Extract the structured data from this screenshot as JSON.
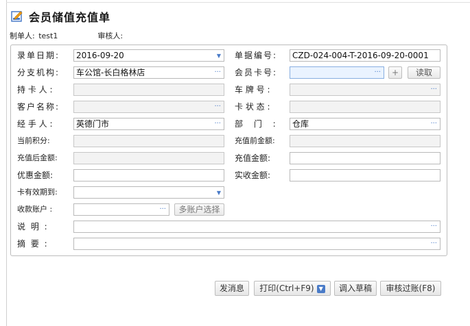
{
  "title": "会员储值充值单",
  "meta": {
    "creator_label": "制单人:",
    "creator_value": "test1",
    "reviewer_label": "审核人:"
  },
  "form": {
    "entry_date": {
      "label": "录单日期:",
      "value": "2016-09-20"
    },
    "doc_no": {
      "label": "单据编号:",
      "value": "CZD-024-004-T-2016-09-20-0001"
    },
    "branch": {
      "label": "分支机构:",
      "value": "车公馆-长白格林店"
    },
    "member_card": {
      "label": "会员卡号:",
      "value": ""
    },
    "cardholder": {
      "label": "持 卡 人 :",
      "value": ""
    },
    "plate_no": {
      "label": "车 牌 号 :",
      "value": ""
    },
    "customer_name": {
      "label": "客户名称:",
      "value": ""
    },
    "card_status": {
      "label": "卡 状 态 :",
      "value": ""
    },
    "handler": {
      "label": "经 手 人 :",
      "value": "英德门市"
    },
    "department": {
      "label": "部  门  :",
      "value": "仓库"
    },
    "current_points": {
      "label": "当前积分:",
      "value": ""
    },
    "pre_recharge": {
      "label": "充值前金额:",
      "value": ""
    },
    "post_recharge": {
      "label": "充值后金额:",
      "value": ""
    },
    "recharge_amount": {
      "label": "充值金额:",
      "value": ""
    },
    "discount_amount": {
      "label": "优惠金额:",
      "value": ""
    },
    "actual_received": {
      "label": "实收金额:",
      "value": ""
    },
    "card_expiry": {
      "label": "卡有效期到:",
      "value": ""
    },
    "receipt_account": {
      "label": "收款账户 :",
      "value": ""
    },
    "multi_account_btn": "多账户选择",
    "remark": {
      "label": "说  明  :",
      "value": ""
    },
    "summary": {
      "label": "摘  要  :",
      "value": ""
    },
    "add_btn": "+",
    "read_btn": "读取"
  },
  "icons": {
    "ellipsis": "···",
    "dropdown": "▼",
    "title_icon": "edit-icon"
  },
  "actions": {
    "send_message": "发消息",
    "print": "打印(Ctrl+F9)",
    "load_draft": "调入草稿",
    "review_post": "审核过账(F8)"
  },
  "colors": {
    "accent": "#4a7bc8",
    "focus_bg": "#eaf3ff",
    "disabled_bg": "#f3f3f3"
  }
}
